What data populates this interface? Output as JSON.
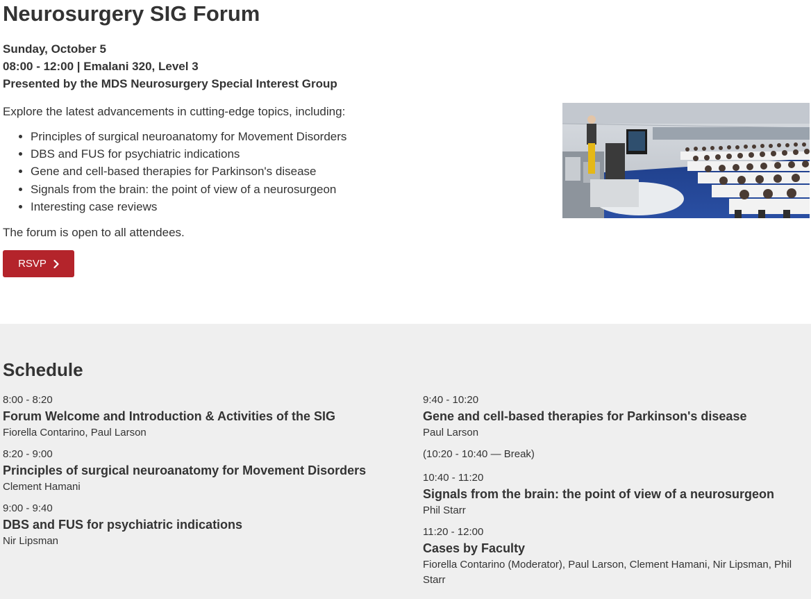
{
  "header": {
    "title": "Neurosurgery SIG Forum",
    "date": "Sunday, October 5",
    "time_location": "08:00 - 12:00 | Emalani 320, Level 3",
    "presenter": "Presented by the MDS Neurosurgery Special Interest Group"
  },
  "intro": "Explore the latest advancements in cutting-edge topics, including:",
  "topics": [
    "Principles of surgical neuroanatomy for Movement Disorders",
    "DBS and FUS for psychiatric indications",
    "Gene and cell-based therapies for Parkinson's disease",
    "Signals from the brain: the point of view of a neurosurgeon",
    "Interesting case reviews"
  ],
  "open_note": "The forum is open to all attendees.",
  "rsvp_label": "RSVP",
  "colors": {
    "accent": "#b4242b",
    "schedule_bg": "#efefef",
    "text": "#333333"
  },
  "schedule": {
    "title": "Schedule",
    "left": [
      {
        "time": "8:00 - 8:20",
        "title": "Forum Welcome and Introduction & Activities of the SIG",
        "speakers": "Fiorella Contarino, Paul Larson"
      },
      {
        "time": "8:20 - 9:00",
        "title": "Principles of surgical neuroanatomy for Movement Disorders",
        "speakers": "Clement Hamani"
      },
      {
        "time": "9:00 - 9:40",
        "title": "DBS and FUS for psychiatric indications",
        "speakers": "Nir Lipsman"
      }
    ],
    "right": [
      {
        "time": "9:40 - 10:20",
        "title": "Gene and cell-based therapies for Parkinson's disease",
        "speakers": "Paul Larson"
      },
      {
        "time": "10:40 - 11:20",
        "title": "Signals from the brain: the point of view of a neurosurgeon",
        "speakers": "Phil Starr"
      },
      {
        "time": "11:20 - 12:00",
        "title": "Cases by Faculty",
        "speakers": "Fiorella Contarino (Moderator), Paul Larson, Clement Hamani, Nir Lipsman, Phil Starr"
      }
    ],
    "break_note": "(10:20 - 10:40 — Break)"
  }
}
